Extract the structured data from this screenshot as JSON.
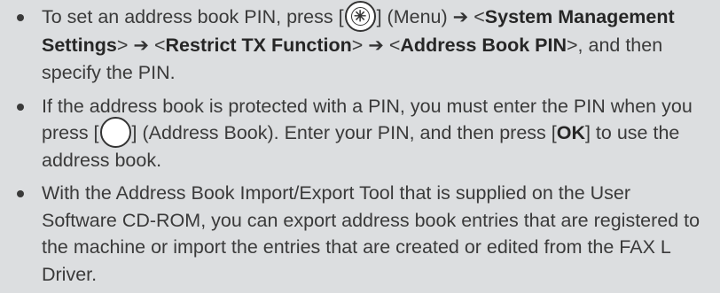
{
  "notes": [
    {
      "parts": [
        "To set an address book PIN, press [",
        "] (Menu) ",
        " <",
        "System Management Settings",
        "> ",
        " <",
        "Restrict TX Function",
        "> ",
        " <",
        "Address Book PIN",
        ">, and then specify the PIN."
      ]
    },
    {
      "parts": [
        "If the address book is protected with a PIN, you must enter the PIN when you press [",
        "] (Address Book). Enter your PIN, and then press [",
        "OK",
        "] to use the address book."
      ]
    },
    {
      "text": "With the Address Book Import/Export Tool that is supplied on the User Software CD-ROM, you can export address book entries that are registered to the machine or import the entries that are created or edited from the FAX L Driver."
    }
  ],
  "icons": {
    "menu_key_glyph": "✳",
    "arrow_glyph": "➔"
  }
}
